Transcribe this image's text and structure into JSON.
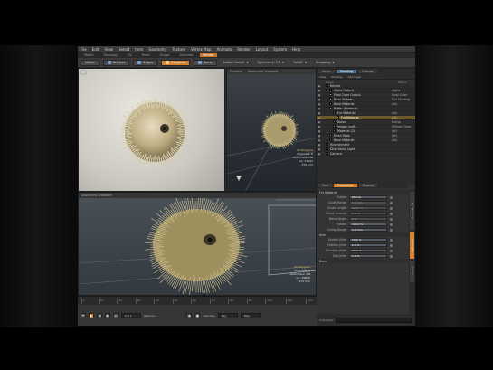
{
  "menubar": [
    "File",
    "Edit",
    "View",
    "Select",
    "Item",
    "Geometry",
    "Texture",
    "Vertex Map",
    "Animate",
    "Render",
    "Layout",
    "System",
    "Help"
  ],
  "layout_tabs": [
    {
      "label": "Model",
      "active": false
    },
    {
      "label": "Topology",
      "active": false
    },
    {
      "label": "UV",
      "active": false
    },
    {
      "label": "Paint",
      "active": false
    },
    {
      "label": "Sculpt",
      "active": false
    },
    {
      "label": "Animate",
      "active": false
    },
    {
      "label": "Render",
      "active": true
    }
  ],
  "toolbar": {
    "mode_label": "Model",
    "vertices_label": "Vertices",
    "edges_label": "Edges",
    "polygons_label": "Polygons",
    "items_label": "Items",
    "action_center_label": "Action Center",
    "symmetry_label": "Symmetry: Off",
    "falloff_label": "Falloff",
    "snapping_label": "Snapping"
  },
  "viewports": {
    "camera_head": [
      "Camera",
      "Advanced Viewport"
    ],
    "main_head": "Advanced Viewport",
    "camera_stats": [
      "All Polygons",
      "Channels: 0",
      "Deformers: ON",
      "GL: 27041",
      "375 mm"
    ],
    "main_stats": [
      "All Polygons",
      "Channels: 0",
      "Deformers: ON",
      "GL: 99856",
      "375 mm"
    ]
  },
  "timeline_ticks": [
    "0",
    "10",
    "20",
    "30",
    "40",
    "50",
    "60",
    "70",
    "80",
    "90",
    "100",
    "110",
    "120"
  ],
  "transport": {
    "time_value": "0.0 s",
    "options_label": "Options...",
    "auto_key_label": "Auto Key",
    "key_label": "Key",
    "play_label": "Play"
  },
  "right_panel": {
    "tabs": [
      {
        "label": "Items",
        "active": false
      },
      {
        "label": "Shading",
        "active": true
      },
      {
        "label": "Groups",
        "active": false
      }
    ],
    "subhead": [
      "View",
      "Shading",
      "Add Layer"
    ],
    "columns": [
      "Name",
      "Effect"
    ],
    "tree": [
      {
        "name": "Render",
        "effect": "",
        "indent": 1,
        "color": "#9a9a9a",
        "sel": false
      },
      {
        "name": "Alpha Output",
        "effect": "Alpha",
        "indent": 2,
        "color": "#cfcfcf",
        "sel": false
      },
      {
        "name": "Final Color Output",
        "effect": "Final Color",
        "indent": 2,
        "color": "#cfcfcf",
        "sel": false
      },
      {
        "name": "Base Shader",
        "effect": "Full Shading",
        "indent": 2,
        "color": "#d4b46a",
        "sel": false
      },
      {
        "name": "Base Material",
        "effect": "(all)",
        "indent": 2,
        "color": "#a05a5a",
        "sel": false
      },
      {
        "name": "Puffer (Material)",
        "effect": "",
        "indent": 2,
        "color": "#8fbf6a",
        "sel": false
      },
      {
        "name": "Fur Material",
        "effect": "(all)",
        "indent": 3,
        "color": "#7a7a7a",
        "sel": false
      },
      {
        "name": "Fur Material",
        "effect": "(all)",
        "indent": 4,
        "color": "#d4b46a",
        "sel": true
      },
      {
        "name": "Noise",
        "effect": "Bump",
        "indent": 3,
        "color": "#7a7a7a",
        "sel": false
      },
      {
        "name": "Image: puff...",
        "effect": "Diffuse Color",
        "indent": 3,
        "color": "#9fa9b5",
        "sel": false
      },
      {
        "name": "Material (2)",
        "effect": "(all)",
        "indent": 3,
        "color": "#a05a5a",
        "sel": false
      },
      {
        "name": "Mesh Mats",
        "effect": "(all)",
        "indent": 2,
        "color": "#8fbf6a",
        "sel": false
      },
      {
        "name": "Base Material",
        "effect": "(all)",
        "indent": 2,
        "color": "#a05a5a",
        "sel": false
      },
      {
        "name": "Environment",
        "effect": "",
        "indent": 1,
        "color": "#6a8fbf",
        "sel": false
      },
      {
        "name": "Directional Light",
        "effect": "",
        "indent": 1,
        "color": "#e0c060",
        "sel": false
      },
      {
        "name": "Camera",
        "effect": "",
        "indent": 1,
        "color": "#9a9a9a",
        "sel": false
      }
    ],
    "props_tabs": [
      {
        "label": "Tool",
        "active": false
      },
      {
        "label": "Properties",
        "active": true
      },
      {
        "label": "Display",
        "active": false
      }
    ],
    "props_section": "Fur Material",
    "props": [
      {
        "label": "Guides",
        "value": "(None)",
        "dim": false
      },
      {
        "label": "Guide Range",
        "value": "0.0 mm",
        "dim": true
      },
      {
        "label": "Guide Length",
        "value": "100.0 %",
        "dim": true
      },
      {
        "label": "Blend Amount",
        "value": "0.0 %",
        "dim": true
      },
      {
        "label": "Blend Angle",
        "value": "0.0°",
        "dim": true
      },
      {
        "label": "Flatten",
        "value": "100.0 %",
        "dim": false
      },
      {
        "label": "Clump Range",
        "value": "0.0 mm",
        "dim": false
      }
    ],
    "props_section2": "Kink",
    "props2": [
      {
        "label": "Growth Jitter",
        "value": "50.0 %",
        "dim": false
      },
      {
        "label": "Position Jitter",
        "value": "0.0 %",
        "dim": false
      },
      {
        "label": "Direction Jitter",
        "value": "20.0 %",
        "dim": false
      },
      {
        "label": "Size Jitter",
        "value": "0.0 %",
        "dim": false
      }
    ],
    "props_section3": "Bend",
    "side_tabs": [
      {
        "label": "Fur Material",
        "active": false
      },
      {
        "label": "Geometry",
        "active": true
      },
      {
        "label": "Vertex",
        "active": false
      }
    ],
    "command_label": "Command"
  }
}
